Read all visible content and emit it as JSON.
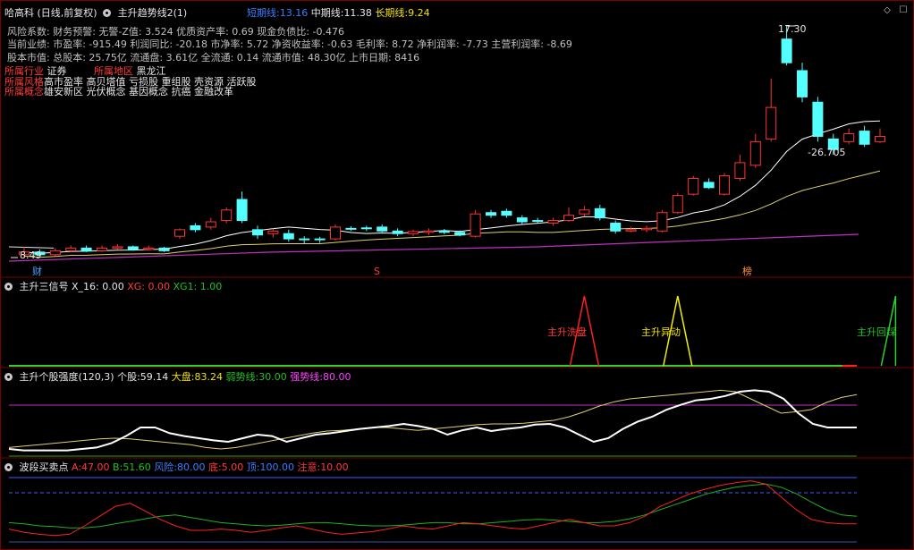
{
  "main_panel": {
    "stock_name": "哈高科",
    "period_mode": "(日线,前复权)",
    "indicator_name": "主升趋势线2(1)",
    "short_line": {
      "label": "短期线:",
      "value": "13.16"
    },
    "mid_line": {
      "label": "中期线:",
      "value": "11.38"
    },
    "long_line": {
      "label": "长期线:",
      "value": "9.24"
    },
    "info_line1": "风险系数: 财务预警: 无警-Z值: 3.524 优质资产率: 0.69 现金负债比: -0.476",
    "info_line2": "当前业绩: 市盈率: -915.49 利润同比: -20.18 市净率: 5.72 净资收益率: -0.63 毛利率: 8.72 净利润率: -7.73 主营利润率: -8.69",
    "info_line3": "股本市值: 总股本: 25.75亿 流通盘: 3.61亿 全流通: 0.14 流通市值: 48.30亿 上市日期: 8416",
    "industry": {
      "label": "所属行业",
      "value": "证券"
    },
    "region": {
      "label": "所属地区",
      "value": "黑龙江"
    },
    "style": {
      "label": "所属风格",
      "value": "高市盈率 高贝塔值 亏损股 重组股 壳资源 活跃股"
    },
    "concept": {
      "label": "所属概念",
      "value": "雄安新区 光伏概念 基因概念 抗癌 金融改革"
    },
    "high_label": "17.30",
    "low_label": "8.49",
    "pct_label": "-26.705",
    "markers": {
      "cai": "财",
      "s": "S",
      "bang": "榜"
    }
  },
  "signal_panel": {
    "title": "主升三信号",
    "x16": {
      "label": "X_16:",
      "value": "0.00"
    },
    "xg": {
      "label": "XG:",
      "value": "0.00"
    },
    "xg1": {
      "label": "XG1:",
      "value": "1.00"
    },
    "signals": [
      "主升洗盘",
      "主升异动",
      "主升回踩"
    ]
  },
  "strength_panel": {
    "title": "主升个股强度(120,3)",
    "stock": {
      "label": "个股:",
      "value": "59.14"
    },
    "market": {
      "label": "大盘:",
      "value": "83.24"
    },
    "weak": {
      "label": "弱势线:",
      "value": "30.00"
    },
    "strong": {
      "label": "强势线:",
      "value": "80.00"
    }
  },
  "wave_panel": {
    "title": "波段买卖点",
    "a": {
      "label": "A:",
      "value": "47.00"
    },
    "b": {
      "label": "B:",
      "value": "51.60"
    },
    "risk": {
      "label": "风险:",
      "value": "80.00"
    },
    "bottom": {
      "label": "底:",
      "value": "5.00"
    },
    "top": {
      "label": "顶:",
      "value": "100.00"
    },
    "attention": {
      "label": "注意:",
      "value": "10.00"
    }
  },
  "chart_data": {
    "type": "candlestick",
    "price_range": [
      8.49,
      17.3
    ],
    "candles": [
      {
        "o": 8.6,
        "c": 8.7,
        "h": 8.9,
        "l": 8.49
      },
      {
        "o": 8.7,
        "c": 8.6,
        "h": 8.8,
        "l": 8.55
      },
      {
        "o": 8.6,
        "c": 8.75,
        "h": 8.85,
        "l": 8.55
      },
      {
        "o": 8.75,
        "c": 8.85,
        "h": 8.95,
        "l": 8.7
      },
      {
        "o": 8.85,
        "c": 8.75,
        "h": 8.95,
        "l": 8.7
      },
      {
        "o": 8.75,
        "c": 8.85,
        "h": 8.95,
        "l": 8.7
      },
      {
        "o": 8.85,
        "c": 8.9,
        "h": 9.0,
        "l": 8.8
      },
      {
        "o": 8.9,
        "c": 8.8,
        "h": 8.95,
        "l": 8.75
      },
      {
        "o": 8.8,
        "c": 8.85,
        "h": 8.95,
        "l": 8.75
      },
      {
        "o": 8.85,
        "c": 8.75,
        "h": 8.9,
        "l": 8.7
      },
      {
        "o": 9.3,
        "c": 9.55,
        "h": 9.6,
        "l": 9.2
      },
      {
        "o": 9.7,
        "c": 9.55,
        "h": 9.8,
        "l": 9.45
      },
      {
        "o": 9.65,
        "c": 9.85,
        "h": 10.0,
        "l": 9.55
      },
      {
        "o": 9.9,
        "c": 10.3,
        "h": 10.4,
        "l": 9.8
      },
      {
        "o": 10.7,
        "c": 9.9,
        "h": 11.0,
        "l": 9.8
      },
      {
        "o": 9.55,
        "c": 9.35,
        "h": 9.7,
        "l": 9.2
      },
      {
        "o": 9.4,
        "c": 9.5,
        "h": 9.6,
        "l": 9.25
      },
      {
        "o": 9.4,
        "c": 9.2,
        "h": 9.55,
        "l": 9.1
      },
      {
        "o": 9.2,
        "c": 9.18,
        "h": 9.3,
        "l": 9.0
      },
      {
        "o": 9.2,
        "c": 9.18,
        "h": 9.28,
        "l": 9.05
      },
      {
        "o": 9.2,
        "c": 9.65,
        "h": 9.75,
        "l": 9.15
      },
      {
        "o": 9.6,
        "c": 9.58,
        "h": 9.68,
        "l": 9.5
      },
      {
        "o": 9.62,
        "c": 9.6,
        "h": 9.7,
        "l": 9.5
      },
      {
        "o": 9.65,
        "c": 9.5,
        "h": 9.75,
        "l": 9.45
      },
      {
        "o": 9.5,
        "c": 9.4,
        "h": 9.6,
        "l": 9.3
      },
      {
        "o": 9.4,
        "c": 9.48,
        "h": 9.55,
        "l": 9.3
      },
      {
        "o": 9.45,
        "c": 9.5,
        "h": 9.6,
        "l": 9.35
      },
      {
        "o": 9.5,
        "c": 9.45,
        "h": 9.58,
        "l": 9.38
      },
      {
        "o": 9.45,
        "c": 9.35,
        "h": 9.52,
        "l": 9.3
      },
      {
        "o": 9.3,
        "c": 10.15,
        "h": 10.3,
        "l": 9.25
      },
      {
        "o": 10.2,
        "c": 10.1,
        "h": 10.3,
        "l": 10.0
      },
      {
        "o": 10.25,
        "c": 10.1,
        "h": 10.35,
        "l": 10.0
      },
      {
        "o": 10.0,
        "c": 9.85,
        "h": 10.1,
        "l": 9.75
      },
      {
        "o": 9.9,
        "c": 9.88,
        "h": 10.0,
        "l": 9.8
      },
      {
        "o": 9.8,
        "c": 9.9,
        "h": 10.0,
        "l": 9.7
      },
      {
        "o": 9.9,
        "c": 10.1,
        "h": 10.4,
        "l": 9.85
      },
      {
        "o": 10.15,
        "c": 10.3,
        "h": 10.45,
        "l": 10.05
      },
      {
        "o": 10.35,
        "c": 10.0,
        "h": 10.5,
        "l": 9.9
      },
      {
        "o": 9.8,
        "c": 9.5,
        "h": 9.9,
        "l": 9.4
      },
      {
        "o": 9.5,
        "c": 9.55,
        "h": 9.65,
        "l": 9.45
      },
      {
        "o": 9.55,
        "c": 9.6,
        "h": 9.7,
        "l": 9.45
      },
      {
        "o": 9.5,
        "c": 10.2,
        "h": 10.3,
        "l": 9.45
      },
      {
        "o": 10.2,
        "c": 10.85,
        "h": 10.95,
        "l": 10.15
      },
      {
        "o": 10.9,
        "c": 11.5,
        "h": 11.6,
        "l": 10.85
      },
      {
        "o": 11.35,
        "c": 11.15,
        "h": 11.5,
        "l": 11.1
      },
      {
        "o": 10.9,
        "c": 11.6,
        "h": 11.7,
        "l": 10.85
      },
      {
        "o": 11.5,
        "c": 12.1,
        "h": 12.4,
        "l": 11.4
      },
      {
        "o": 12.0,
        "c": 12.9,
        "h": 13.2,
        "l": 11.9
      },
      {
        "o": 13.0,
        "c": 14.2,
        "h": 15.3,
        "l": 12.9
      },
      {
        "o": 16.8,
        "c": 15.9,
        "h": 17.3,
        "l": 15.8
      },
      {
        "o": 15.6,
        "c": 14.6,
        "h": 15.9,
        "l": 14.4
      },
      {
        "o": 14.4,
        "c": 13.1,
        "h": 14.6,
        "l": 12.9
      },
      {
        "o": 13.0,
        "c": 12.6,
        "h": 13.2,
        "l": 12.4
      },
      {
        "o": 12.9,
        "c": 13.2,
        "h": 13.4,
        "l": 12.8
      },
      {
        "o": 13.3,
        "c": 12.8,
        "h": 13.5,
        "l": 12.7
      },
      {
        "o": 12.9,
        "c": 13.1,
        "h": 13.4,
        "l": 12.85
      }
    ],
    "signal_spikes": [
      {
        "name": "主升洗盘",
        "index": 36,
        "color": "#ff2020"
      },
      {
        "name": "主升异动",
        "index": 42,
        "color": "#f0f000"
      },
      {
        "name": "主升回踩",
        "index": 56,
        "color": "#30d030"
      }
    ]
  }
}
